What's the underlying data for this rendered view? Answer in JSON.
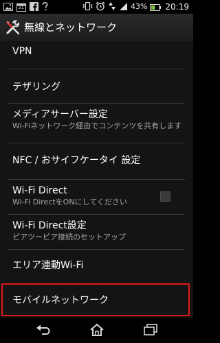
{
  "status_bar": {
    "battery_percent": "43%",
    "time": "20:19",
    "calendar_day": "31",
    "icons": [
      "image-icon",
      "calendar-icon",
      "facebook-icon",
      "help-icon",
      "vibrate-icon",
      "alarm-icon",
      "data-icon",
      "signal-icon",
      "battery-icon"
    ]
  },
  "action_bar": {
    "title": "無線とネットワーク",
    "icon": "wrench-screwdriver-icon"
  },
  "items": [
    {
      "title": "VPN",
      "summary": ""
    },
    {
      "title": "テザリング",
      "summary": ""
    },
    {
      "title": "メディアサーバー設定",
      "summary": "Wi-Fiネットワーク経由でコンテンツを共有します"
    },
    {
      "title": "NFC / おサイフケータイ 設定",
      "summary": ""
    },
    {
      "title": "Wi-Fi Direct",
      "summary": "Wi-Fi DirectをONにしてください",
      "checkbox": false
    },
    {
      "title": "Wi-Fi Direct設定",
      "summary": "ピアツーピア接続のセットアップ"
    },
    {
      "title": "エリア連動Wi-Fi",
      "summary": ""
    },
    {
      "title": "モバイルネットワーク",
      "summary": "",
      "highlighted": true
    }
  ],
  "nav_bar": {
    "icons": [
      "back-icon",
      "home-icon",
      "recent-apps-icon"
    ]
  }
}
